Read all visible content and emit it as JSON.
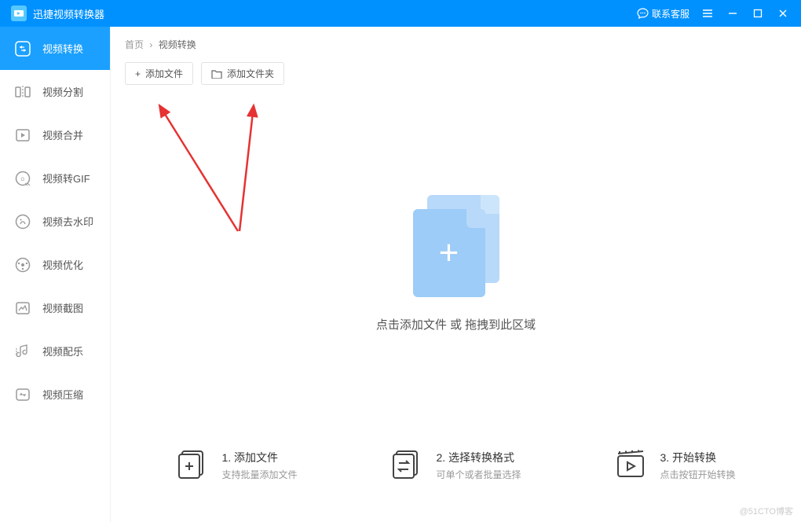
{
  "titlebar": {
    "title": "迅捷视频转换器",
    "contact": "联系客服"
  },
  "sidebar": {
    "items": [
      {
        "label": "视频转换"
      },
      {
        "label": "视频分割"
      },
      {
        "label": "视频合并"
      },
      {
        "label": "视频转GIF"
      },
      {
        "label": "视频去水印"
      },
      {
        "label": "视频优化"
      },
      {
        "label": "视频截图"
      },
      {
        "label": "视频配乐"
      },
      {
        "label": "视频压缩"
      }
    ]
  },
  "breadcrumb": {
    "home": "首页",
    "current": "视频转换"
  },
  "toolbar": {
    "addFile": "添加文件",
    "addFolder": "添加文件夹"
  },
  "dropzone": {
    "text": "点击添加文件 或 拖拽到此区域"
  },
  "steps": [
    {
      "title": "1. 添加文件",
      "sub": "支持批量添加文件"
    },
    {
      "title": "2. 选择转换格式",
      "sub": "可单个或者批量选择"
    },
    {
      "title": "3. 开始转换",
      "sub": "点击按钮开始转换"
    }
  ],
  "watermark": "@51CTO博客"
}
